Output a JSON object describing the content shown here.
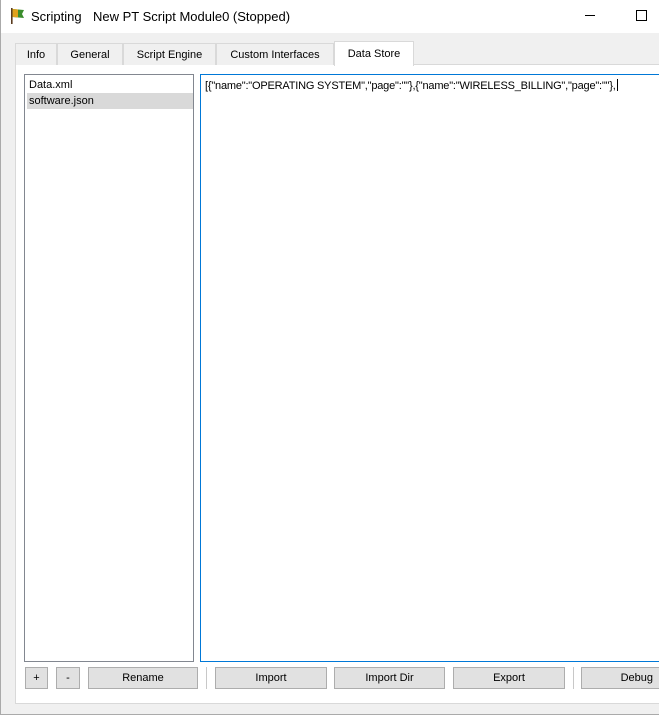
{
  "titlebar": {
    "app_name": "Scripting",
    "window_title": "New PT Script Module0 (Stopped)"
  },
  "tabs": [
    {
      "label": "Info"
    },
    {
      "label": "General"
    },
    {
      "label": "Script Engine"
    },
    {
      "label": "Custom Interfaces"
    },
    {
      "label": "Data Store",
      "active": true
    }
  ],
  "files": [
    {
      "name": "Data.xml",
      "selected": false
    },
    {
      "name": "software.json",
      "selected": true
    }
  ],
  "editor": {
    "content": "[{\"name\":\"OPERATING SYSTEM\",\"page\":\"\"},{\"name\":\"WIRELESS_BILLING\",\"page\":\"\"},"
  },
  "buttons": {
    "add": "+",
    "remove": "-",
    "rename": "Rename",
    "import": "Import",
    "import_dir": "Import Dir",
    "export": "Export",
    "debug": "Debug"
  },
  "colors": {
    "focus_border": "#0078d7",
    "selection": "#d9d9d9",
    "button_face": "#e1e1e1"
  }
}
